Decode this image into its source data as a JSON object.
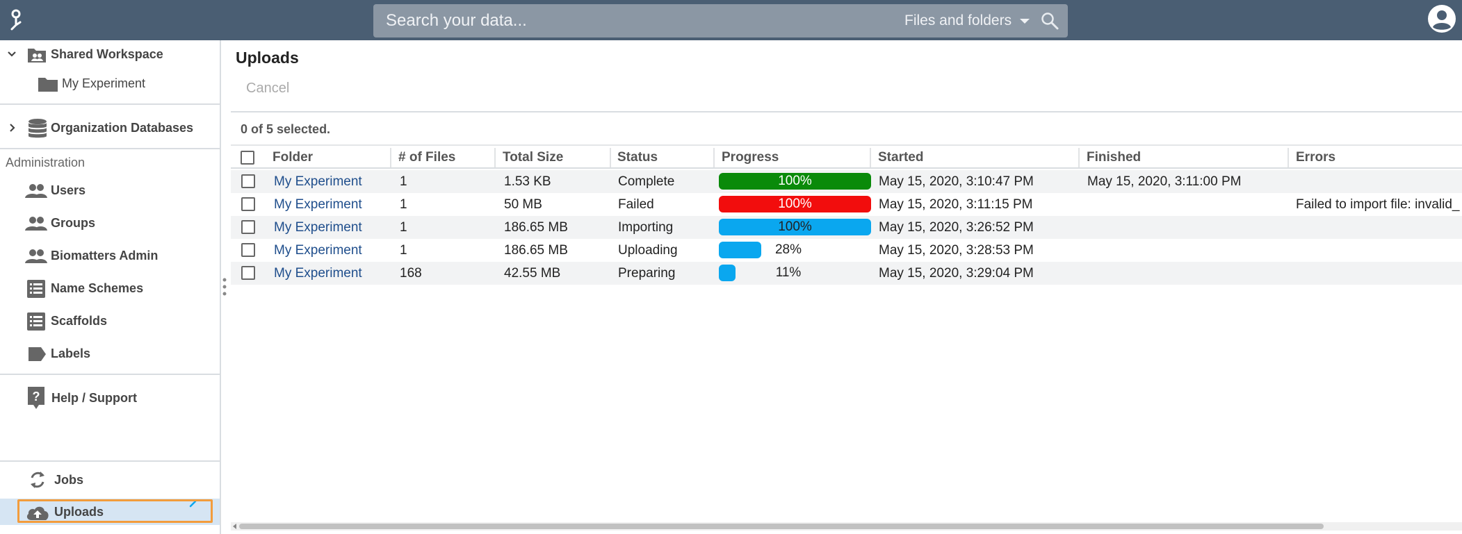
{
  "header": {
    "search_placeholder": "Search your data...",
    "search_scope": "Files and folders"
  },
  "sidebar": {
    "shared_workspace": "Shared Workspace",
    "my_experiment": "My Experiment",
    "org_databases": "Organization Databases",
    "section_admin": "Administration",
    "admin_items": [
      "Users",
      "Groups",
      "Biomatters Admin",
      "Name Schemes",
      "Scaffolds",
      "Labels"
    ],
    "help": "Help / Support",
    "jobs": "Jobs",
    "uploads": "Uploads"
  },
  "main": {
    "title": "Uploads",
    "cancel_label": "Cancel",
    "selection_status": "0 of 5 selected.",
    "columns": [
      "Folder",
      "# of Files",
      "Total Size",
      "Status",
      "Progress",
      "Started",
      "Finished",
      "Errors"
    ],
    "rows": [
      {
        "folder": "My Experiment",
        "files": "1",
        "size": "1.53 KB",
        "status": "Complete",
        "progress": 100,
        "progress_label": "100%",
        "progress_color": "#0a8a0a",
        "label_color": "#ffffff",
        "started": "May 15, 2020, 3:10:47 PM",
        "finished": "May 15, 2020, 3:11:00 PM",
        "errors": ""
      },
      {
        "folder": "My Experiment",
        "files": "1",
        "size": "50 MB",
        "status": "Failed",
        "progress": 100,
        "progress_label": "100%",
        "progress_color": "#f20d0d",
        "label_color": "#ffffff",
        "started": "May 15, 2020, 3:11:15 PM",
        "finished": "",
        "errors": "Failed to import file: invalid_"
      },
      {
        "folder": "My Experiment",
        "files": "1",
        "size": "186.65 MB",
        "status": "Importing",
        "progress": 100,
        "progress_label": "100%",
        "progress_color": "#0aa7ef",
        "label_color": "#222222",
        "started": "May 15, 2020, 3:26:52 PM",
        "finished": "",
        "errors": ""
      },
      {
        "folder": "My Experiment",
        "files": "1",
        "size": "186.65 MB",
        "status": "Uploading",
        "progress": 28,
        "progress_label": "28%",
        "progress_color": "#0aa7ef",
        "label_color": "#222222",
        "started": "May 15, 2020, 3:28:53 PM",
        "finished": "",
        "errors": ""
      },
      {
        "folder": "My Experiment",
        "files": "168",
        "size": "42.55 MB",
        "status": "Preparing",
        "progress": 11,
        "progress_label": "11%",
        "progress_color": "#0aa7ef",
        "label_color": "#222222",
        "started": "May 15, 2020, 3:29:04 PM",
        "finished": "",
        "errors": ""
      }
    ]
  }
}
